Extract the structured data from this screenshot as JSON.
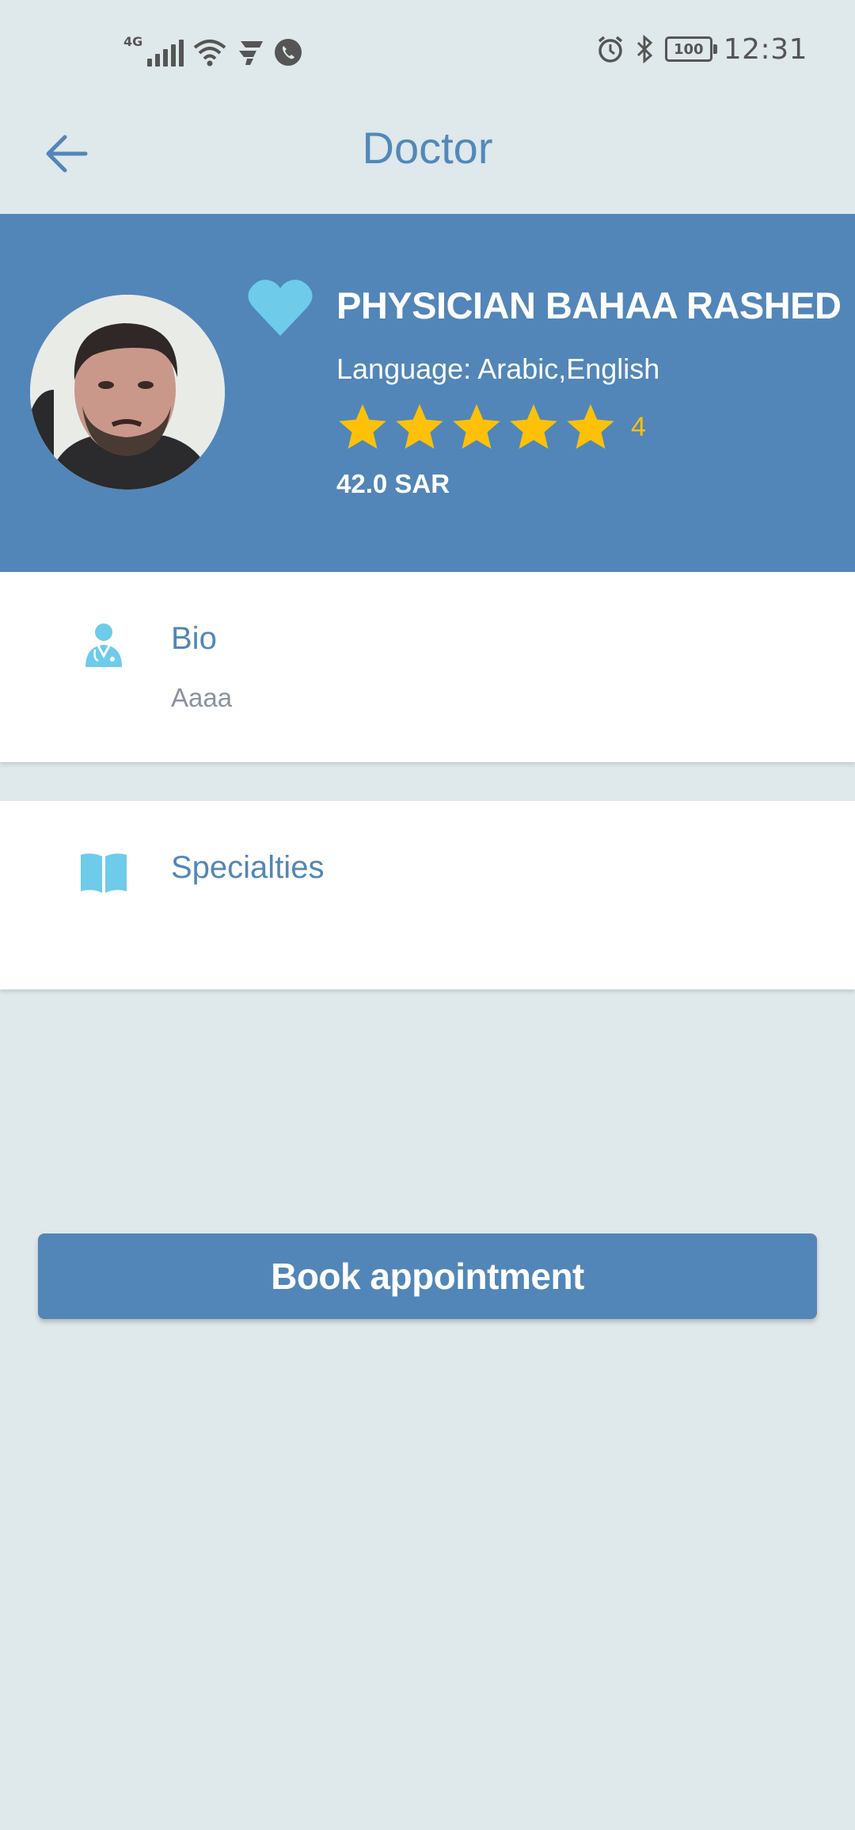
{
  "status_bar": {
    "network_label": "4G",
    "battery": "100",
    "time": "12:31",
    "icons": [
      "signal-icon",
      "wifi-icon",
      "app-notification-icon",
      "phone-call-icon",
      "alarm-icon",
      "bluetooth-icon",
      "battery-icon"
    ]
  },
  "app_bar": {
    "title": "Doctor",
    "back_icon": "arrow-left-icon"
  },
  "profile": {
    "name": "PHYSICIAN BAHAA RASHED",
    "language": "Language: Arabic,English",
    "rating_value": "4",
    "stars_filled": 5,
    "stars_total": 5,
    "price": "42.0 SAR",
    "favorite_icon": "heart-icon"
  },
  "sections": {
    "bio": {
      "title": "Bio",
      "text": "Aaaa",
      "icon": "doctor-icon"
    },
    "specialties": {
      "title": "Specialties",
      "icon": "book-icon"
    }
  },
  "actions": {
    "book_label": "Book appointment"
  },
  "colors": {
    "primary": "#5286b8",
    "background": "#dfe8eb",
    "accent_light_blue": "#6ecbea",
    "star": "#ffc107"
  }
}
